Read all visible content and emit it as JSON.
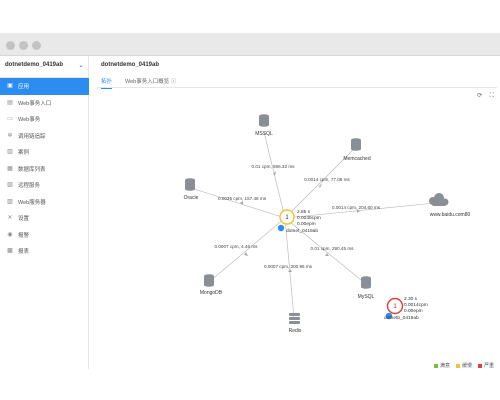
{
  "app": {
    "name": "dotnetdemo_0419ab"
  },
  "sidebar": {
    "items": [
      {
        "label": "应用",
        "icon": "app-icon",
        "active": true
      },
      {
        "label": "Web事务入口",
        "icon": "web-entry-icon"
      },
      {
        "label": "Web事务",
        "icon": "web-transaction-icon"
      },
      {
        "label": "调用链追踪",
        "icon": "trace-icon"
      },
      {
        "label": "案例",
        "icon": "case-icon"
      },
      {
        "label": "数据库列表",
        "icon": "database-icon"
      },
      {
        "label": "远程服务",
        "icon": "remote-service-icon"
      },
      {
        "label": "Web服务器",
        "icon": "web-server-icon"
      },
      {
        "label": "设置",
        "icon": "settings-icon"
      },
      {
        "label": "报警",
        "icon": "alarm-icon"
      },
      {
        "label": "报表",
        "icon": "report-icon"
      }
    ]
  },
  "main": {
    "title": "dotnetdemo_0419ab",
    "tabs": [
      {
        "label": "拓扑",
        "active": true
      },
      {
        "label": "Web事务入口概览 ⓘ",
        "active": false
      }
    ]
  },
  "topology": {
    "nodes": {
      "mssql": "MSSQL",
      "memcached": "Memcached",
      "oracle": "Oracle",
      "baidu": "www.baidu.com80",
      "mongodb": "MongoDB",
      "mysql": "MySQL",
      "redis": "Redis",
      "center": {
        "name": "dotnet_0419ab",
        "count": "1",
        "badge": "2.85 s",
        "cpm": "0.0035cpm",
        "epm": "0.00epm"
      },
      "remote": {
        "name": "dotnetb_0419ab",
        "count": "1",
        "badge": "2.30 s",
        "cpm": "0.0014cpm",
        "epm": "0.00epm"
      }
    },
    "edges": {
      "mssql": "0.01 cpm, 596.32 ms",
      "memcached": "0.0014 cpm, 77.08 ms",
      "oracle": "0.0035 cpm, 157.48 ms",
      "baidu": "0.0014 cpm, 204.60 ms",
      "mongodb": "0.0007 cpm, 4.46 ms",
      "redis": "0.0007 cpm, 300.96 ms",
      "mysql": "0.01 cpm, 290.45 ms"
    }
  },
  "legend": [
    {
      "label": "满意",
      "color": "#7cbf3f"
    },
    {
      "label": "缓慢",
      "color": "#f2c12e"
    },
    {
      "label": "严重",
      "color": "#e23b3b"
    }
  ],
  "colors": {
    "accent": "#2d8cf0",
    "edge": "#b5b5b5",
    "node_gray": "#8a8f95"
  }
}
